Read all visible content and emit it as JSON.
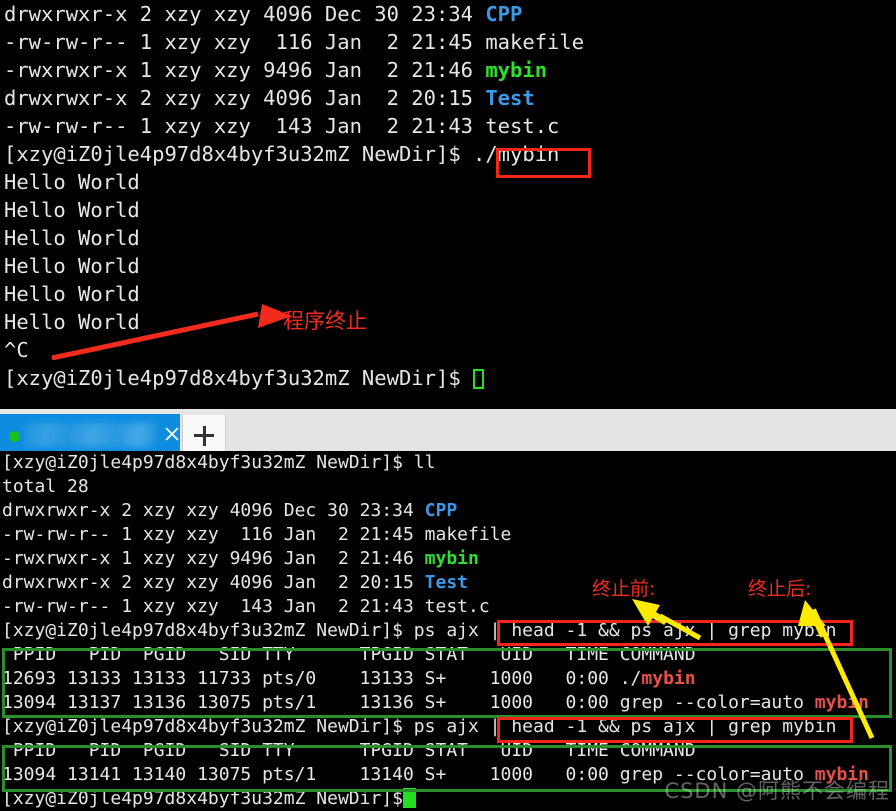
{
  "meta": {
    "watermark": "CSDN @阿熊不会编程",
    "prompt": "[xzy@iZ0jle4p97d8x4byf3u32mZ NewDir]$ ",
    "colors": {
      "terminal_bg": "#000000",
      "terminal_fg": "#d8d8d8",
      "dir_blue": "#3b9ae8",
      "exec_green": "#2ee02e",
      "grep_red": "#e8504a",
      "annotation_red": "#f22b1e",
      "annotation_yellow": "#ffeb00",
      "box_red": "#f5251a",
      "box_green": "#2a8f2a",
      "tab_active_blue": "#0d8ce0",
      "tab_bar_grey": "#e4e4e4",
      "cursor_green": "#23e023"
    }
  },
  "tabbar": {
    "active_tab_title": "",
    "close_label": "×",
    "new_tab_label": "+",
    "status_dot": "running"
  },
  "top_terminal": {
    "lines": [
      {
        "id": "ll-cpp",
        "parts": [
          {
            "t": "drwxrwxr-x 2 xzy xzy 4096 Dec 30 23:34 ",
            "c": "white"
          },
          {
            "t": "CPP",
            "c": "blue"
          }
        ]
      },
      {
        "id": "ll-makefile",
        "parts": [
          {
            "t": "-rw-rw-r-- 1 xzy xzy  116 Jan  2 21:45 makefile",
            "c": "white"
          }
        ]
      },
      {
        "id": "ll-mybin",
        "parts": [
          {
            "t": "-rwxrwxr-x 1 xzy xzy 9496 Jan  2 21:46 ",
            "c": "white"
          },
          {
            "t": "mybin",
            "c": "green"
          }
        ]
      },
      {
        "id": "ll-test-dir",
        "parts": [
          {
            "t": "drwxrwxr-x 2 xzy xzy 4096 Jan  2 20:15 ",
            "c": "white"
          },
          {
            "t": "Test",
            "c": "blue"
          }
        ]
      },
      {
        "id": "ll-test-c",
        "parts": [
          {
            "t": "-rw-rw-r-- 1 xzy xzy  143 Jan  2 21:43 test.c",
            "c": "white"
          }
        ]
      },
      {
        "id": "cmd-run-mybin",
        "parts": [
          {
            "t": "[xzy@iZ0jle4p97d8x4byf3u32mZ NewDir]$ ./mybin",
            "c": "white"
          }
        ]
      },
      {
        "id": "out-1",
        "parts": [
          {
            "t": "Hello World",
            "c": "white"
          }
        ]
      },
      {
        "id": "out-2",
        "parts": [
          {
            "t": "Hello World",
            "c": "white"
          }
        ]
      },
      {
        "id": "out-3",
        "parts": [
          {
            "t": "Hello World",
            "c": "white"
          }
        ]
      },
      {
        "id": "out-4",
        "parts": [
          {
            "t": "Hello World",
            "c": "white"
          }
        ]
      },
      {
        "id": "out-5",
        "parts": [
          {
            "t": "Hello World",
            "c": "white"
          }
        ]
      },
      {
        "id": "out-6",
        "parts": [
          {
            "t": "Hello World",
            "c": "white"
          }
        ]
      },
      {
        "id": "sigint",
        "parts": [
          {
            "t": "^C",
            "c": "white"
          }
        ]
      },
      {
        "id": "prompt-idle",
        "parts": [
          {
            "t": "[xzy@iZ0jle4p97d8x4byf3u32mZ NewDir]$ ",
            "c": "white"
          }
        ],
        "cursor": "hollow"
      }
    ]
  },
  "bottom_terminal": {
    "lines": [
      {
        "id": "cmd-ll",
        "parts": [
          {
            "t": "[xzy@iZ0jle4p97d8x4byf3u32mZ NewDir]$ ll",
            "c": "white"
          }
        ]
      },
      {
        "id": "total",
        "parts": [
          {
            "t": "total 28",
            "c": "white"
          }
        ]
      },
      {
        "id": "ll2-cpp",
        "parts": [
          {
            "t": "drwxrwxr-x 2 xzy xzy 4096 Dec 30 23:34 ",
            "c": "white"
          },
          {
            "t": "CPP",
            "c": "blue"
          }
        ]
      },
      {
        "id": "ll2-makefile",
        "parts": [
          {
            "t": "-rw-rw-r-- 1 xzy xzy  116 Jan  2 21:45 makefile",
            "c": "white"
          }
        ]
      },
      {
        "id": "ll2-mybin",
        "parts": [
          {
            "t": "-rwxrwxr-x 1 xzy xzy 9496 Jan  2 21:46 ",
            "c": "white"
          },
          {
            "t": "mybin",
            "c": "green"
          }
        ]
      },
      {
        "id": "ll2-test-dir",
        "parts": [
          {
            "t": "drwxrwxr-x 2 xzy xzy 4096 Jan  2 20:15 ",
            "c": "white"
          },
          {
            "t": "Test",
            "c": "blue"
          }
        ]
      },
      {
        "id": "ll2-test-c",
        "parts": [
          {
            "t": "-rw-rw-r-- 1 xzy xzy  143 Jan  2 21:43 test.c",
            "c": "white"
          }
        ]
      },
      {
        "id": "cmd-ps-1",
        "parts": [
          {
            "t": "[xzy@iZ0jle4p97d8x4byf3u32mZ NewDir]$ ps ajx | head -1 && ps ajx | grep mybin",
            "c": "white"
          }
        ]
      },
      {
        "id": "ps-header-1",
        "parts": [
          {
            "t": " PPID   PID  PGID   SID TTY      TPGID STAT   UID   TIME COMMAND",
            "c": "white"
          }
        ]
      },
      {
        "id": "ps-row-1",
        "parts": [
          {
            "t": "12693 13133 13133 11733 pts/0    13133 S+    1000   0:00 ./",
            "c": "white"
          },
          {
            "t": "mybin",
            "c": "red"
          }
        ]
      },
      {
        "id": "ps-row-2",
        "parts": [
          {
            "t": "13094 13137 13136 13075 pts/1    13136 S+    1000   0:00 grep --color=auto ",
            "c": "white"
          },
          {
            "t": "mybin",
            "c": "red"
          }
        ]
      },
      {
        "id": "cmd-ps-2",
        "parts": [
          {
            "t": "[xzy@iZ0jle4p97d8x4byf3u32mZ NewDir]$ ps ajx | head -1 && ps ajx | grep mybin",
            "c": "white"
          }
        ]
      },
      {
        "id": "ps-header-2",
        "parts": [
          {
            "t": " PPID   PID  PGID   SID TTY      TPGID STAT   UID   TIME COMMAND",
            "c": "white"
          }
        ]
      },
      {
        "id": "ps-row-3",
        "parts": [
          {
            "t": "13094 13141 13140 13075 pts/1    13140 S+    1000   0:00 grep --color=auto ",
            "c": "white"
          },
          {
            "t": "mybin",
            "c": "red"
          }
        ]
      },
      {
        "id": "prompt-final",
        "parts": [
          {
            "t": "[xzy@iZ0jle4p97d8x4byf3u32mZ NewDir]$",
            "c": "white"
          }
        ],
        "cursor": "solid"
      }
    ]
  },
  "annotations": {
    "program_terminated": "程序终止",
    "before_terminate": "终止前:",
    "after_terminate": "终止后:"
  },
  "ps_table_data": {
    "columns": [
      "PPID",
      "PID",
      "PGID",
      "SID",
      "TTY",
      "TPGID",
      "STAT",
      "UID",
      "TIME",
      "COMMAND"
    ],
    "before_termination": [
      [
        "12693",
        "13133",
        "13133",
        "11733",
        "pts/0",
        "13133",
        "S+",
        "1000",
        "0:00",
        "./mybin"
      ],
      [
        "13094",
        "13137",
        "13136",
        "13075",
        "pts/1",
        "13136",
        "S+",
        "1000",
        "0:00",
        "grep --color=auto mybin"
      ]
    ],
    "after_termination": [
      [
        "13094",
        "13141",
        "13140",
        "13075",
        "pts/1",
        "13140",
        "S+",
        "1000",
        "0:00",
        "grep --color=auto mybin"
      ]
    ]
  },
  "file_listing": {
    "total_blocks": "28",
    "rows": [
      {
        "perms": "drwxrwxr-x",
        "links": "2",
        "owner": "xzy",
        "group": "xzy",
        "size": "4096",
        "month": "Dec",
        "day": "30",
        "time": "23:34",
        "name": "CPP",
        "kind": "directory"
      },
      {
        "perms": "-rw-rw-r--",
        "links": "1",
        "owner": "xzy",
        "group": "xzy",
        "size": "116",
        "month": "Jan",
        "day": "2",
        "time": "21:45",
        "name": "makefile",
        "kind": "file"
      },
      {
        "perms": "-rwxrwxr-x",
        "links": "1",
        "owner": "xzy",
        "group": "xzy",
        "size": "9496",
        "month": "Jan",
        "day": "2",
        "time": "21:46",
        "name": "mybin",
        "kind": "executable"
      },
      {
        "perms": "drwxrwxr-x",
        "links": "2",
        "owner": "xzy",
        "group": "xzy",
        "size": "4096",
        "month": "Jan",
        "day": "2",
        "time": "20:15",
        "name": "Test",
        "kind": "directory"
      },
      {
        "perms": "-rw-rw-r--",
        "links": "1",
        "owner": "xzy",
        "group": "xzy",
        "size": "143",
        "month": "Jan",
        "day": "2",
        "time": "21:43",
        "name": "test.c",
        "kind": "file"
      }
    ]
  }
}
